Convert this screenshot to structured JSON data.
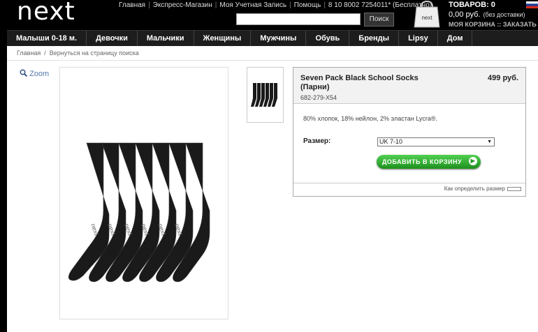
{
  "header": {
    "logo": "next",
    "links": [
      "Главная",
      "Экспресс-Магазин",
      "Моя Учетная Запись",
      "Помощь"
    ],
    "phone": "8 10 8002 7254011* (Бесплатно)",
    "search_button": "Поиск",
    "search_value": "",
    "bag_logo": "next",
    "basket": {
      "count_label": "ТОВАРОВ: 0",
      "total": "0,00 руб.",
      "delivery_note": "(без доставки)",
      "my_basket": "МОЯ КОРЗИНА",
      "separator": "::",
      "checkout": "ЗАКАЗАТЬ"
    },
    "flag_icon": "russia-flag-icon"
  },
  "nav": {
    "items": [
      "Малыши 0-18 м.",
      "Девочки",
      "Мальчики",
      "Женщины",
      "Мужчины",
      "Обувь",
      "Бренды",
      "Lipsy",
      "Дом"
    ]
  },
  "breadcrumb": {
    "home": "Главная",
    "separator": "/",
    "back": "Вернуться на страницу поиска"
  },
  "zoom": {
    "label": "Zoom",
    "icon": "magnifier-icon"
  },
  "product": {
    "title": "Seven Pack Black School Socks (Парни)",
    "price": "499 руб.",
    "sku": "682-279-X54",
    "description": "80% хлопок, 18% нейлон, 2% эластан Lycra®.",
    "size_label": "Размер:",
    "size_value": "UK 7-10",
    "add_to_cart": "ДОБАВИТЬ В КОРЗИНУ",
    "size_help": "Как определить размер",
    "sock_brand": "next"
  },
  "colors": {
    "header_bg": "#000000",
    "nav_bg": "#1d1d1d",
    "button_green": "#2eae2e",
    "link_blue": "#5577aa"
  }
}
